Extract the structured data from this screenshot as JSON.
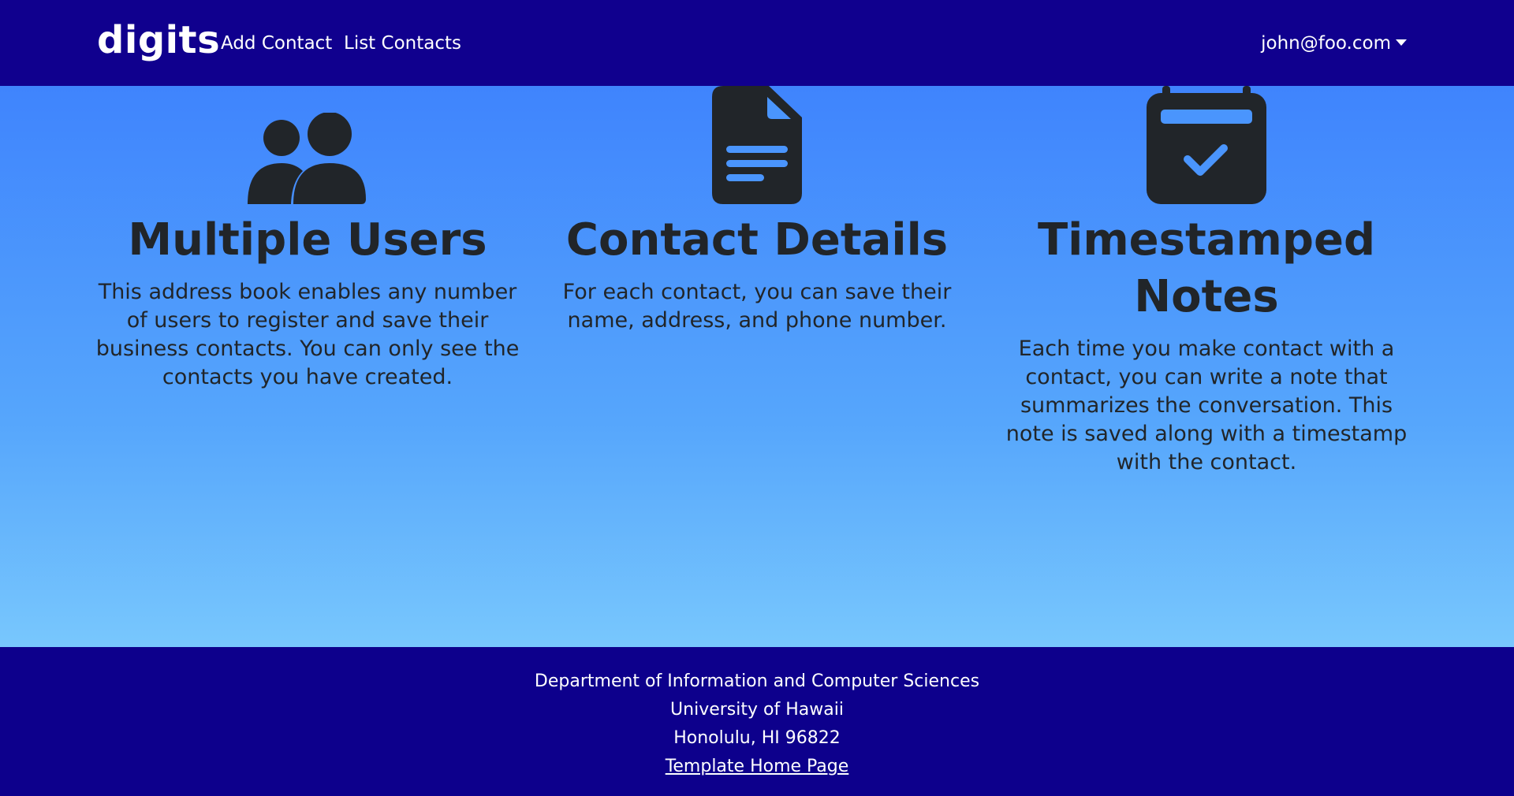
{
  "navbar": {
    "brand": "digits",
    "links": [
      {
        "label": "Add Contact"
      },
      {
        "label": "List Contacts"
      }
    ],
    "user": "john@foo.com"
  },
  "features": [
    {
      "icon": "people-icon",
      "title": "Multiple Users",
      "text": "This address book enables any number of users to register and save their business contacts. You can only see the contacts you have created."
    },
    {
      "icon": "file-text-icon",
      "title": "Contact Details",
      "text": "For each contact, you can save their name, address, and phone number."
    },
    {
      "icon": "calendar-check-icon",
      "title": "Timestamped Notes",
      "text": "Each time you make contact with a contact, you can write a note that summarizes the conversation. This note is saved along with a timestamp with the contact."
    }
  ],
  "footer": {
    "line1": "Department of Information and Computer Sciences",
    "line2": "University of Hawaii",
    "line3": "Honolulu, HI 96822",
    "link": "Template Home Page"
  },
  "colors": {
    "navbar": "#10008e",
    "footer": "#0d008c",
    "hero_top": "#3f84fd",
    "hero_bottom": "#78c7fd",
    "icon": "#212529"
  }
}
